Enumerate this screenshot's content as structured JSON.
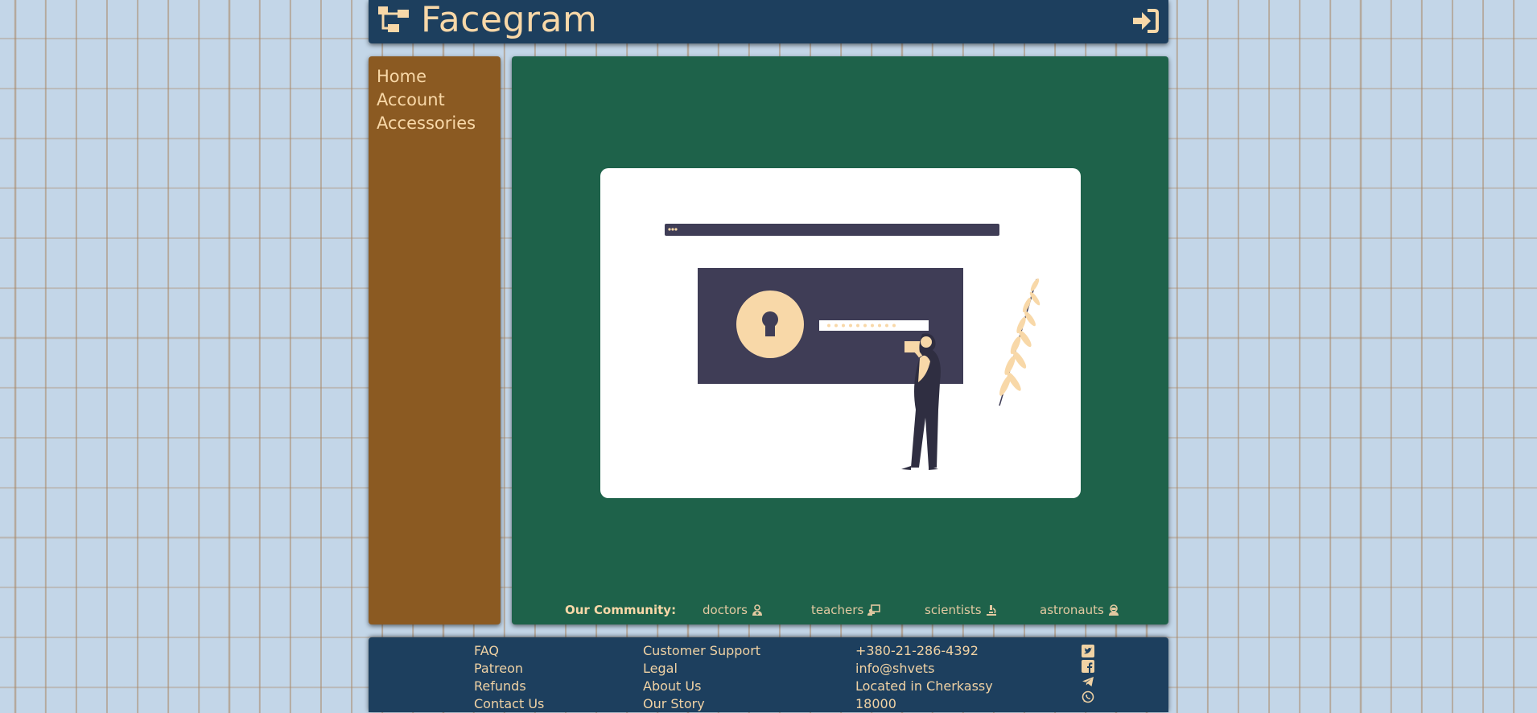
{
  "header": {
    "brand_name": "Facegram",
    "brand_icon": "sitemap-icon",
    "login_icon": "sign-in-icon"
  },
  "sidebar": {
    "items": [
      {
        "label": "Home"
      },
      {
        "label": "Account"
      },
      {
        "label": "Accessories"
      }
    ]
  },
  "main": {
    "hero_illustration": "secure-login-illustration",
    "community": {
      "label": "Our Community:",
      "links": [
        {
          "label": "doctors",
          "icon": "user-doctor-icon"
        },
        {
          "label": "teachers",
          "icon": "chalkboard-teacher-icon"
        },
        {
          "label": "scientists",
          "icon": "microscope-icon"
        },
        {
          "label": "astronauts",
          "icon": "user-astronaut-icon"
        }
      ]
    }
  },
  "footer": {
    "col1": [
      "FAQ",
      "Patreon",
      "Refunds",
      "Contact Us"
    ],
    "col2": [
      "Customer Support",
      "Legal",
      "About Us",
      "Our Story"
    ],
    "col3": [
      "+380-21-286-4392",
      "info@shvets",
      "Located in Cherkassy",
      "18000"
    ],
    "social": [
      "twitter-icon",
      "facebook-icon",
      "telegram-icon",
      "whatsapp-icon"
    ]
  },
  "colors": {
    "header_bg": "#1d3f5e",
    "sidebar_bg": "#8b5a22",
    "main_bg": "#1e624a",
    "accent_text": "#f8d8a8",
    "page_bg": "#c3d6e8"
  }
}
